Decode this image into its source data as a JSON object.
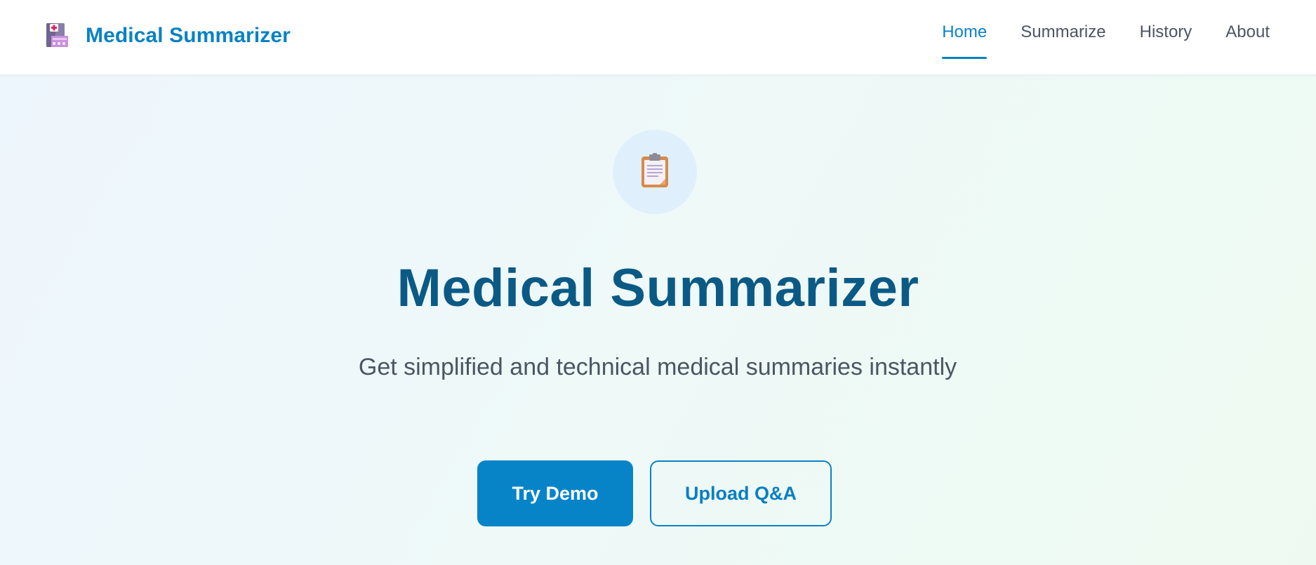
{
  "brand": {
    "name": "Medical Summarizer",
    "icon": "hospital-icon"
  },
  "nav": {
    "items": [
      {
        "label": "Home",
        "active": true
      },
      {
        "label": "Summarize",
        "active": false
      },
      {
        "label": "History",
        "active": false
      },
      {
        "label": "About",
        "active": false
      }
    ]
  },
  "hero": {
    "icon": "clipboard-icon",
    "title": "Medical Summarizer",
    "subtitle": "Get simplified and technical medical summaries instantly",
    "primary_button": "Try Demo",
    "secondary_button": "Upload Q&A"
  },
  "colors": {
    "accent": "#0a82c4",
    "title": "#0b5a85",
    "text": "#4b5563"
  }
}
